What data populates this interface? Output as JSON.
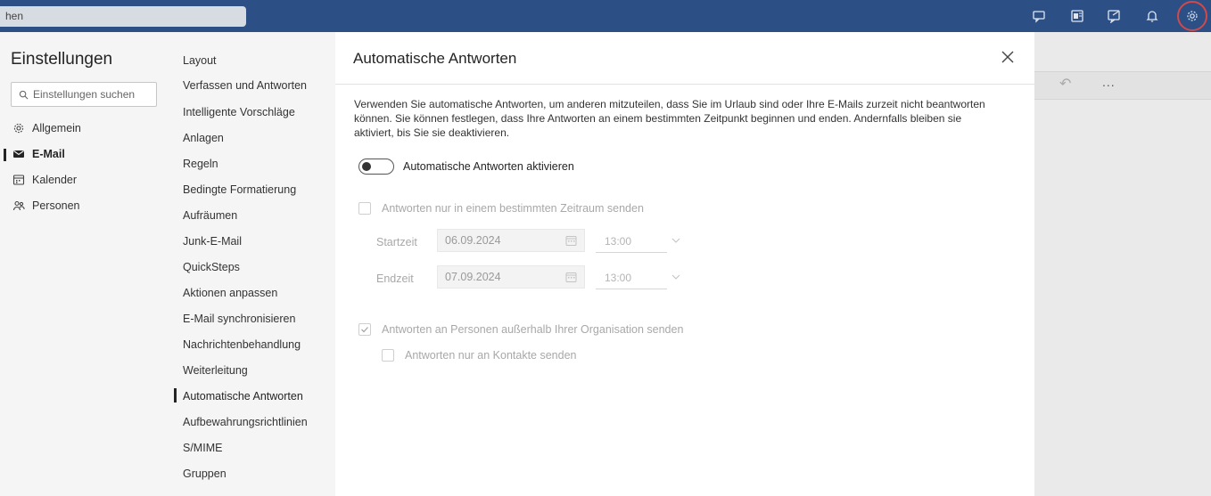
{
  "topbar": {
    "search_text": "hen",
    "icons": [
      "chat-icon",
      "outlook-icon",
      "feedback-icon",
      "bell-icon",
      "gear-icon"
    ]
  },
  "settings": {
    "title": "Einstellungen",
    "search_placeholder": "Einstellungen suchen",
    "categories": [
      {
        "label": "Allgemein",
        "icon": "gear-icon"
      },
      {
        "label": "E-Mail",
        "icon": "mail-icon",
        "active": true
      },
      {
        "label": "Kalender",
        "icon": "calendar-icon"
      },
      {
        "label": "Personen",
        "icon": "people-icon"
      }
    ],
    "subcategories": [
      "Layout",
      "Verfassen und Antworten",
      "Intelligente Vorschläge",
      "Anlagen",
      "Regeln",
      "Bedingte Formatierung",
      "Aufräumen",
      "Junk-E-Mail",
      "QuickSteps",
      "Aktionen anpassen",
      "E-Mail synchronisieren",
      "Nachrichtenbehandlung",
      "Weiterleitung",
      "Automatische Antworten",
      "Aufbewahrungsrichtlinien",
      "S/MIME",
      "Gruppen"
    ],
    "active_subcategory": "Automatische Antworten"
  },
  "panel": {
    "title": "Automatische Antworten",
    "description": "Verwenden Sie automatische Antworten, um anderen mitzuteilen, dass Sie im Urlaub sind oder Ihre E-Mails zurzeit nicht beantworten können. Sie können festlegen, dass Ihre Antworten an einem bestimmten Zeitpunkt beginnen und enden. Andernfalls bleiben sie aktiviert, bis Sie sie deaktivieren.",
    "toggle_label": "Automatische Antworten aktivieren",
    "toggle_on": false,
    "timeframe_label": "Antworten nur in einem bestimmten Zeitraum senden",
    "start_label": "Startzeit",
    "start_date": "06.09.2024",
    "start_time": "13:00",
    "end_label": "Endzeit",
    "end_date": "07.09.2024",
    "end_time": "13:00",
    "outside_label": "Antworten an Personen außerhalb Ihrer Organisation senden",
    "outside_checked": true,
    "contacts_label": "Antworten nur an Kontakte senden",
    "contacts_checked": false
  },
  "background_toolbar": {
    "more_label": "..."
  }
}
